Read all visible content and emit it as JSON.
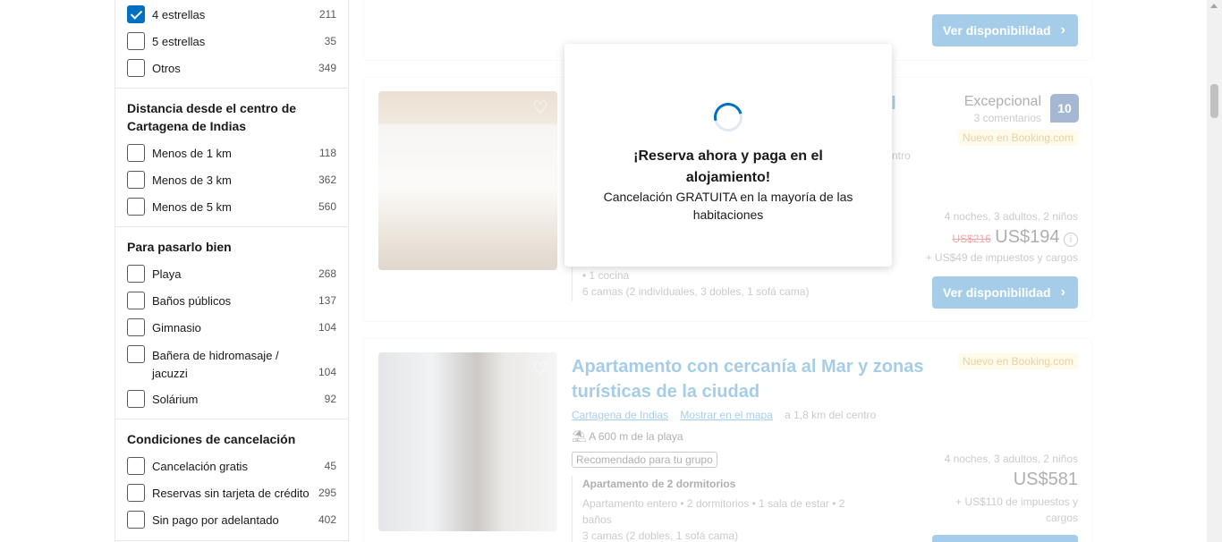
{
  "sidebar": {
    "stars_group": {
      "rows": [
        {
          "label": "4 estrellas",
          "count": "211",
          "checked": true
        },
        {
          "label": "5 estrellas",
          "count": "35",
          "checked": false
        },
        {
          "label": "Otros",
          "count": "349",
          "checked": false
        }
      ]
    },
    "distance_group": {
      "title": "Distancia desde el centro de Cartagena de Indias",
      "rows": [
        {
          "label": "Menos de 1 km",
          "count": "118"
        },
        {
          "label": "Menos de 3 km",
          "count": "362"
        },
        {
          "label": "Menos de 5 km",
          "count": "560"
        }
      ]
    },
    "fun_group": {
      "title": "Para pasarlo bien",
      "rows": [
        {
          "label": "Playa",
          "count": "268"
        },
        {
          "label": "Baños públicos",
          "count": "137"
        },
        {
          "label": "Gimnasio",
          "count": "104"
        },
        {
          "label": "Bañera de hidromasaje / jacuzzi",
          "count": "104"
        },
        {
          "label": "Solárium",
          "count": "92"
        }
      ]
    },
    "cancel_group": {
      "title": "Condiciones de cancelación",
      "rows": [
        {
          "label": "Cancelación gratis",
          "count": "45"
        },
        {
          "label": "Reservas sin tarjeta de crédito",
          "count": "295"
        },
        {
          "label": "Sin pago por adelantado",
          "count": "402"
        }
      ]
    }
  },
  "results": {
    "card0": {
      "button": "Ver disponibilidad"
    },
    "card1": {
      "title_fragment": "al",
      "rating_word": "Excepcional",
      "reviews": "3 comentarios",
      "score": "10",
      "new_badge": "Nuevo en Booking.com",
      "distance_fragment": "ntro",
      "stay": "4 noches, 3 adultos, 2 niños",
      "old_price": "US$216",
      "price": "US$194",
      "taxes": "+ US$49 de impuestos y cargos",
      "room_line1": "• 1 cocina",
      "room_line2": "6 camas (2 individuales, 3 dobles, 1 sofá cama)",
      "button": "Ver disponibilidad"
    },
    "card2": {
      "title_line1": "Apartamento con cercanía al Mar y zonas",
      "title_line2": "turísticas de la ciudad",
      "city_link": "Cartagena de Indias",
      "map_link": "Mostrar en el mapa",
      "distance": "a 1,8 km del centro",
      "beach": "A 600 m de la playa",
      "rec_tag": "Recomendado para tu grupo",
      "room_title": "Apartamento de 2 dormitorios",
      "room_line1": "Apartamento entero • 2 dormitorios • 1 sala de estar • 2 baños",
      "room_line2": "3 camas (2 dobles, 1 sofá cama)",
      "new_badge": "Nuevo en Booking.com",
      "stay": "4 noches, 3 adultos, 2 niños",
      "price": "US$581",
      "taxes_line1": "+ US$110 de impuestos y",
      "taxes_line2": "cargos"
    }
  },
  "modal": {
    "title": "¡Reserva ahora y paga en el alojamiento!",
    "subtitle": "Cancelación GRATUITA en la mayoría de las habitaciones"
  },
  "colors": {
    "accent": "#0071c2",
    "new_badge_bg": "#fff2c6",
    "score_bg": "#003580"
  },
  "icons": [
    "check-icon",
    "heart-icon",
    "chevron-right-icon",
    "beach-icon",
    "info-icon",
    "loading-spinner"
  ]
}
